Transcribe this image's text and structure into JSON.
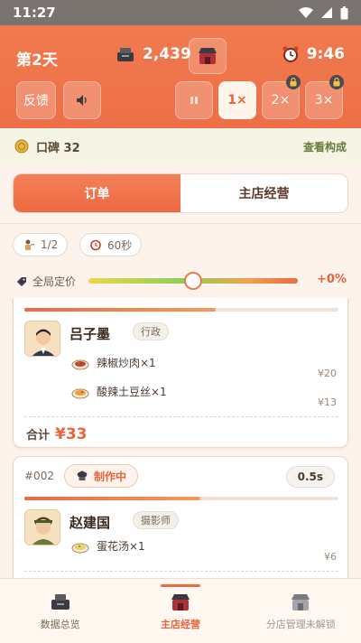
{
  "status_bar": {
    "time": "11:27"
  },
  "header": {
    "day": "第2天",
    "money": "2,439",
    "clock": "9:46",
    "feedback_label": "反馈",
    "speeds": [
      "1×",
      "2×",
      "3×"
    ]
  },
  "reputation": {
    "label": "口碑 32",
    "link": "查看构成"
  },
  "tabs": [
    "订单",
    "主店经营"
  ],
  "chips": {
    "customers": "1/2",
    "timer": "60秒"
  },
  "pricing": {
    "label": "全局定价",
    "value": "+0%",
    "slider_position": 0.5
  },
  "orders": [
    {
      "name": "吕子墨",
      "tag": "行政",
      "progress": 0.61,
      "items": [
        {
          "name": "辣椒炒肉×1",
          "price": "¥20"
        },
        {
          "name": "酸辣土豆丝×1",
          "price": "¥13"
        }
      ],
      "total_label": "合计",
      "total": "¥33"
    },
    {
      "id": "#002",
      "status": "制作中",
      "timer": "0.5s",
      "name": "赵建国",
      "tag": "摄影师",
      "progress": 0.56,
      "items": [
        {
          "name": "蛋花汤×1",
          "price": "¥6"
        }
      ]
    }
  ],
  "bottom_nav": [
    "数据总览",
    "主店经营",
    "分店管理未解锁"
  ]
}
